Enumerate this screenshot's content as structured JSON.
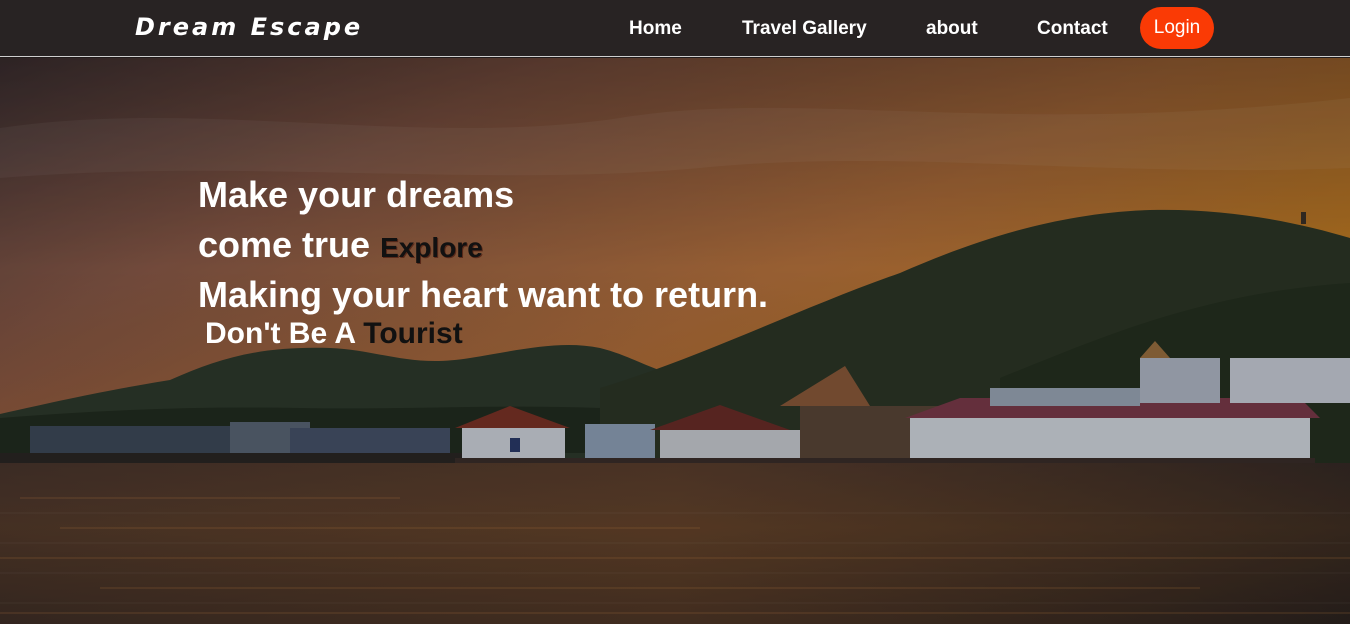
{
  "brand": {
    "name": "Dream Escape"
  },
  "nav": {
    "home": "Home",
    "gallery": "Travel Gallery",
    "about": "about",
    "contact": "Contact",
    "login": "Login"
  },
  "hero": {
    "line1": "Make your dreams",
    "line2": "come true",
    "explore": "Explore",
    "line3": "Making your heart want to return.",
    "tagline_part1": "Don't Be A",
    "tagline_part2": "Tourist"
  },
  "colors": {
    "navbar_bg": "#282323",
    "login_bg": "#fa3a05",
    "text_light": "#ffffff",
    "text_dark": "#111111"
  }
}
